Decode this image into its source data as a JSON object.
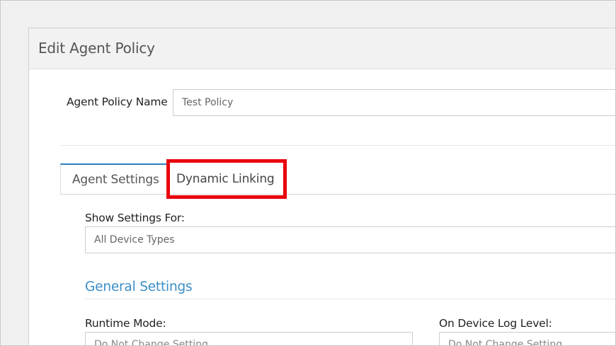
{
  "panel": {
    "title": "Edit Agent Policy"
  },
  "policy_name": {
    "label": "Agent Policy Name",
    "value": "Test Policy"
  },
  "tabs": [
    {
      "label": "Agent Settings",
      "active": true
    },
    {
      "label": "Dynamic Linking",
      "active": false,
      "highlighted": true
    }
  ],
  "show_settings": {
    "label": "Show Settings For:",
    "placeholder": "All Device Types"
  },
  "general": {
    "title": "General Settings"
  },
  "runtime_mode": {
    "label": "Runtime Mode:",
    "value": "Do Not Change Setting"
  },
  "log_level": {
    "label": "On Device Log Level:",
    "value": "Do Not Change Setting"
  },
  "colors": {
    "accent": "#3a8dc8",
    "highlight": "#e8000d",
    "tab_border": "#2f7fc1"
  }
}
